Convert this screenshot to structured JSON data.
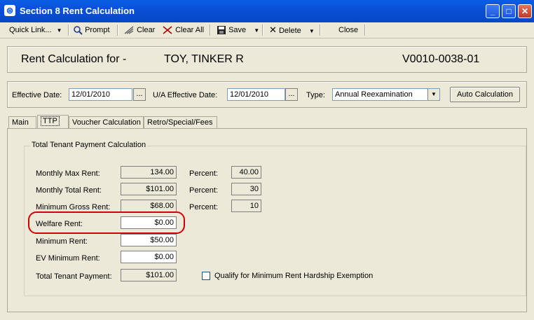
{
  "window": {
    "title": "Section 8 Rent Calculation"
  },
  "toolbar": {
    "quick_link": "Quick Link...",
    "prompt": "Prompt",
    "clear": "Clear",
    "clear_all": "Clear All",
    "save": "Save",
    "delete": "Delete",
    "close": "Close"
  },
  "header": {
    "label": "Rent Calculation for -",
    "tenant_name": "TOY, TINKER R",
    "voucher_id": "V0010-0038-01"
  },
  "filters": {
    "effective_date_label": "Effective Date:",
    "effective_date": "12/01/2010",
    "ua_effective_date_label": "U/A Effective Date:",
    "ua_effective_date": "12/01/2010",
    "type_label": "Type:",
    "type_value": "Annual Reexamination",
    "auto_calc": "Auto Calculation",
    "ellipsis": "..."
  },
  "tabs": [
    {
      "label": "Main"
    },
    {
      "label": "TTP"
    },
    {
      "label": "Voucher Calculation"
    },
    {
      "label": "Retro/Special/Fees"
    }
  ],
  "ttp": {
    "group_title": "Total Tenant Payment Calculation",
    "rows": [
      {
        "label": "Monthly Max Rent:",
        "value": "134.00"
      },
      {
        "label": "Monthly Total Rent:",
        "value": "$101.00"
      },
      {
        "label": "Minimum Gross Rent:",
        "value": "$68.00"
      },
      {
        "label": "Welfare Rent:",
        "value": "$0.00"
      },
      {
        "label": "Minimum Rent:",
        "value": "$50.00"
      },
      {
        "label": "EV Minimum Rent:",
        "value": "$0.00"
      },
      {
        "label": "Total Tenant Payment:",
        "value": "$101.00"
      }
    ],
    "percent_label": "Percent:",
    "percents": [
      "40.00",
      "30",
      "10"
    ],
    "hardship_label": "Qualify for Minimum Rent Hardship Exemption"
  }
}
